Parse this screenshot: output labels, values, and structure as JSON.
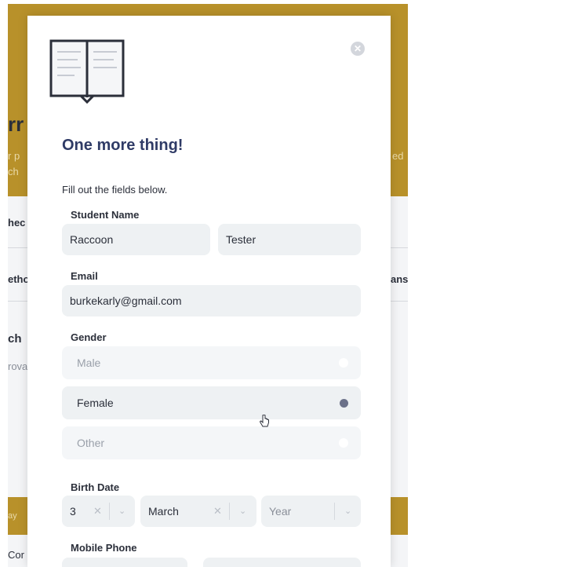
{
  "background": {
    "banner_heading": "rr",
    "banner_line1_left": "r p",
    "banner_line1_right": "ed",
    "banner_line2_left": "ch",
    "row1_left": "hec",
    "row2_left": "etho",
    "row2_right": "ans",
    "row3_left": "ch",
    "row4_left": "rova",
    "footer_left": "ay",
    "bottom_left": "Cor"
  },
  "modal": {
    "close_symbol": "✕",
    "title": "One more thing!",
    "subtitle": "Fill out the fields below.",
    "student_name": {
      "label": "Student Name",
      "first": "Raccoon",
      "last": "Tester"
    },
    "email": {
      "label": "Email",
      "value": "burkekarly@gmail.com"
    },
    "gender": {
      "label": "Gender",
      "options": [
        "Male",
        "Female",
        "Other"
      ],
      "selected": "Female"
    },
    "birth_date": {
      "label": "Birth Date",
      "day": "3",
      "month": "March",
      "year_placeholder": "Year"
    },
    "mobile_phone": {
      "label": "Mobile Phone"
    }
  },
  "colors": {
    "banner": "#b8912a",
    "title": "#2f3b66",
    "field_bg": "#eef1f3",
    "radio_selected_dot": "#6b7189"
  },
  "icons": [
    "book-icon",
    "close-icon",
    "clear-icon",
    "chevron-down-icon",
    "pointer-cursor-icon"
  ]
}
